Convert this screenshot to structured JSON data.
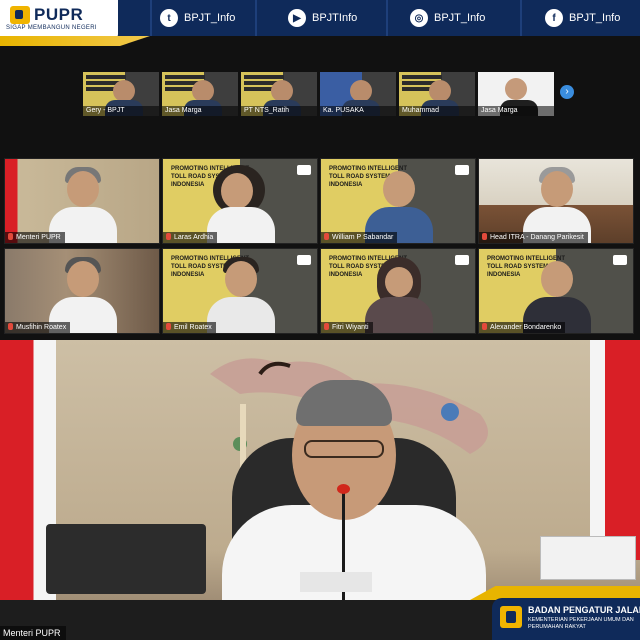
{
  "brand": {
    "logo_text": "PUPR",
    "tagline": "SIGAP MEMBANGUN NEGERI"
  },
  "social": [
    {
      "icon": "twitter-icon",
      "glyph": "t",
      "handle": "BPJT_Info"
    },
    {
      "icon": "youtube-icon",
      "glyph": "▶",
      "handle": "BPJTInfo"
    },
    {
      "icon": "instagram-icon",
      "glyph": "◎",
      "handle": "BPJT_Info"
    },
    {
      "icon": "facebook-icon",
      "glyph": "f",
      "handle": "BPJT_Info"
    }
  ],
  "thumbnails": [
    "Gery - BPJT",
    "Jasa Marga",
    "PT NTS_Ratih",
    "Ka. PUSAKA",
    "Muhammad",
    "Jasa Marga"
  ],
  "slide_title": "PROMOTING INTELLIGENT TOLL ROAD SYSTEM IN INDONESIA",
  "tiles": [
    "Menteri PUPR",
    "Laras Ardhia",
    "William P Sabandar",
    "Head ITRA - Danang Parikesit",
    "Musfihin Roatex",
    "Emil Roatex",
    "Fitri Wiyanti",
    "Alexander Bondarenko"
  ],
  "main_speaker": "Menteri PUPR",
  "bpjt": {
    "title": "BADAN PENGATUR JALAN TOL",
    "sub1": "KEMENTERIAN PEKERJAAN UMUM DAN",
    "sub2": "PERUMAHAN RAKYAT"
  },
  "colors": {
    "navy": "#0f2a5a",
    "gold": "#e8b400",
    "flag_red": "#d91f26",
    "mic_active": "#e24a3b"
  }
}
